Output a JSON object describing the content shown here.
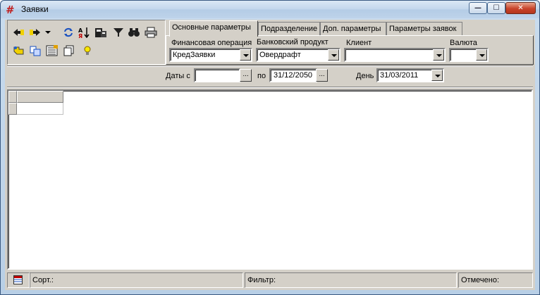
{
  "window": {
    "title": "Заявки",
    "controls": {
      "minimize": "—",
      "maximize": "☐",
      "close": "✕"
    }
  },
  "toolbar": {
    "icons": [
      "arrow-left-icon",
      "arrow-right-icon",
      "dropdown-icon",
      "refresh-icon",
      "sort-icon",
      "calculator-icon",
      "filter-icon",
      "binoculars-icon",
      "printer-icon",
      "pointer-icon",
      "copy-icon",
      "report-icon",
      "pages-icon",
      "bulb-icon"
    ]
  },
  "tabs": [
    {
      "label": "Основные параметры",
      "active": true
    },
    {
      "label": "Подразделение",
      "active": false
    },
    {
      "label": "Доп. параметры",
      "active": false
    },
    {
      "label": "Параметры заявок",
      "active": false
    }
  ],
  "fields": {
    "financial_operation": {
      "label": "Финансовая операция",
      "value": "КредЗаявки"
    },
    "bank_product": {
      "label": "Банковский продукт",
      "value": "Овердрафт"
    },
    "client": {
      "label": "Клиент",
      "value": ""
    },
    "currency": {
      "label": "Валюта",
      "value": ""
    }
  },
  "dates": {
    "from_label": "Даты с",
    "from_value": "",
    "to_label": "по",
    "to_value": "31/12/2050",
    "day_label": "День",
    "day_value": "31/03/2011",
    "ellipsis": "..."
  },
  "status": {
    "sort_label": "Сорт.:",
    "filter_label": "Фильтр:",
    "marked_label": "Отмечено:"
  },
  "colors": {
    "dialog_face": "#d4d0c8",
    "title_gradient_top": "#dbe8f5",
    "close_button": "#c8432a"
  }
}
